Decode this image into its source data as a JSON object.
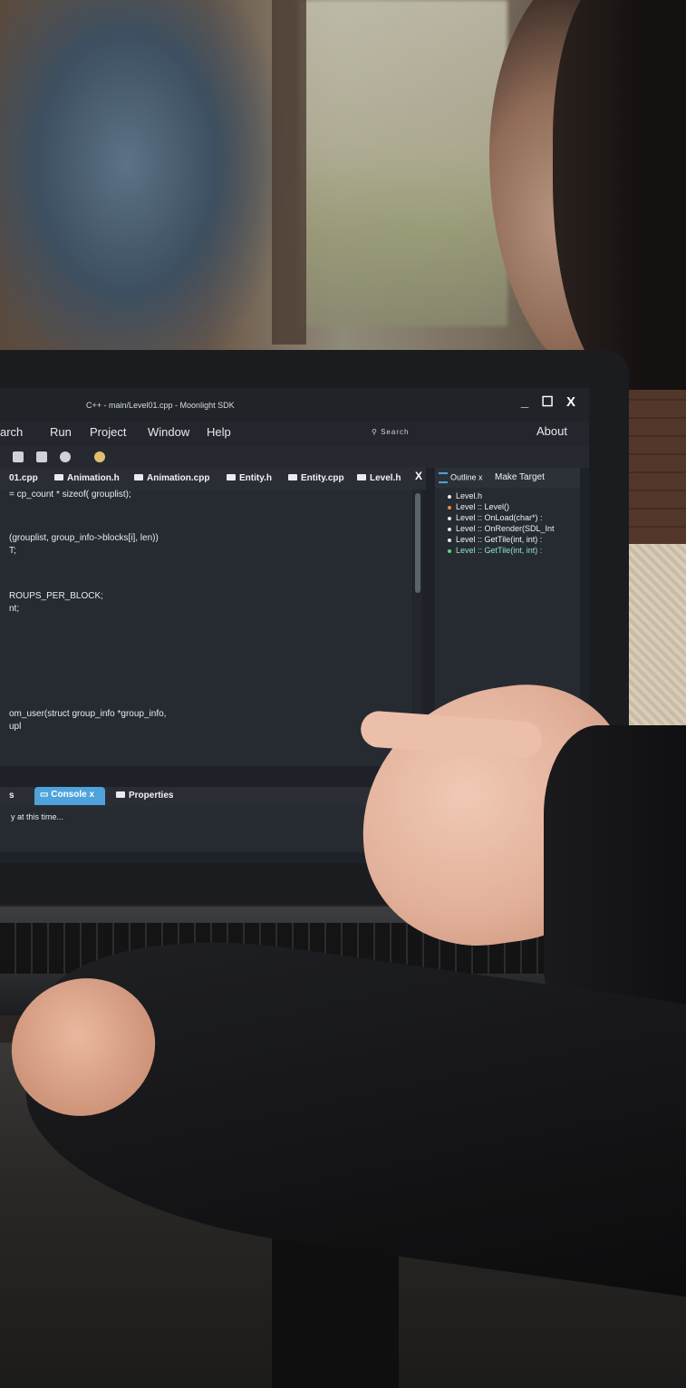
{
  "ide": {
    "window_title": "C++ - main/Level01.cpp - Moonlight SDK",
    "window_controls": "_ ☐ X",
    "menu": [
      "arch",
      "Run",
      "Project",
      "Window",
      "Help"
    ],
    "search_label": "Search",
    "about_label": "About",
    "editor_tabs": [
      "01.cpp",
      "Animation.h",
      "Animation.cpp",
      "Entity.h",
      "Entity.cpp",
      "Level.h"
    ],
    "tab_close": "X",
    "code_lines": [
      "= cp_count * sizeof( grouplist);",
      "(grouplist, group_info->blocks[i], len))",
      "T;",
      "ROUPS_PER_BLOCK;",
      "nt;",
      "om_user(struct group_info *group_info,",
      "upl"
    ],
    "outline_tabs": {
      "outline": "Outline",
      "outline_close": "x",
      "make_target": "Make Target"
    },
    "outline_items": [
      {
        "label": "Level.h",
        "color": "#e8ecef"
      },
      {
        "label": "Level :: Level()",
        "color": "#f08b3a"
      },
      {
        "label": "Level :: OnLoad(char*)  :  ",
        "color": "#e8ecef"
      },
      {
        "label": "Level :: OnRender(SDL_Int",
        "color": "#e8ecef"
      },
      {
        "label": "Level :: GetTile(int, int)  :",
        "color": "#e8ecef"
      },
      {
        "label": "Level :: GetTile(int, int)  :",
        "color": "#5fd38e"
      }
    ],
    "bottom_tabs": {
      "prev": "s",
      "console": "Console",
      "console_close": "x",
      "properties": "Properties"
    },
    "console_text": "y at this time..."
  }
}
